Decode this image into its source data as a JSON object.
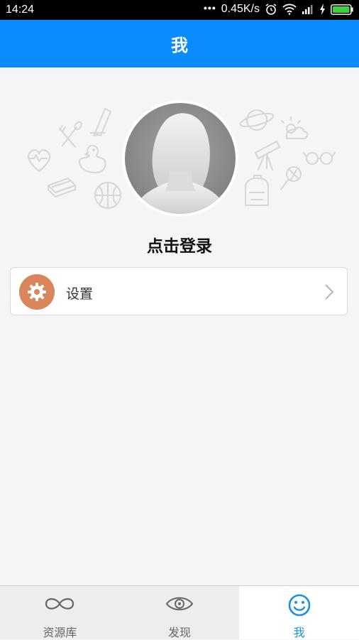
{
  "status_bar": {
    "time": "14:24",
    "dots": "•••",
    "network_speed": "0.45K/s",
    "icons": [
      "alarm-icon",
      "wifi-icon",
      "signal-icon",
      "charging-icon",
      "battery-icon"
    ]
  },
  "header": {
    "title": "我"
  },
  "profile": {
    "login_label": "点击登录"
  },
  "menu": {
    "settings_label": "设置"
  },
  "tabs": [
    {
      "label": "资源库",
      "icon": "infinity-icon",
      "active": false
    },
    {
      "label": "发现",
      "icon": "eye-icon",
      "active": false
    },
    {
      "label": "我",
      "icon": "smiley-icon",
      "active": true
    }
  ],
  "colors": {
    "header_bg": "#0a8cff",
    "settings_icon_bg": "#d9875a",
    "active_tab": "#1a8fe3"
  }
}
